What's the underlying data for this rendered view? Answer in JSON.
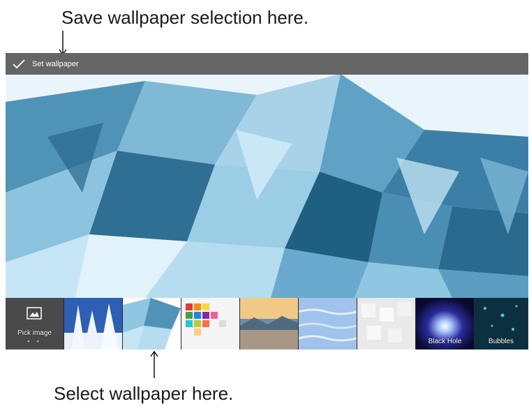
{
  "annotations": {
    "top": "Save wallpaper selection here.",
    "bottom": "Select wallpaper here."
  },
  "action_bar": {
    "icon": "check-icon",
    "label": "Set wallpaper"
  },
  "thumbnails": [
    {
      "id": "pick-image",
      "label": "Pick image",
      "icon": "image-icon"
    },
    {
      "id": "snow-trees",
      "label": ""
    },
    {
      "id": "blue-polygons",
      "label": "",
      "selected": true
    },
    {
      "id": "color-squares",
      "label": ""
    },
    {
      "id": "landscape",
      "label": ""
    },
    {
      "id": "water",
      "label": ""
    },
    {
      "id": "white-cubes",
      "label": ""
    },
    {
      "id": "black-hole",
      "label": "Black Hole"
    },
    {
      "id": "bubbles",
      "label": "Bubbles"
    }
  ],
  "colors": {
    "action_bar": "#585858",
    "polygon_dark": "#1f5f82",
    "polygon_light": "#c7e6f5"
  }
}
